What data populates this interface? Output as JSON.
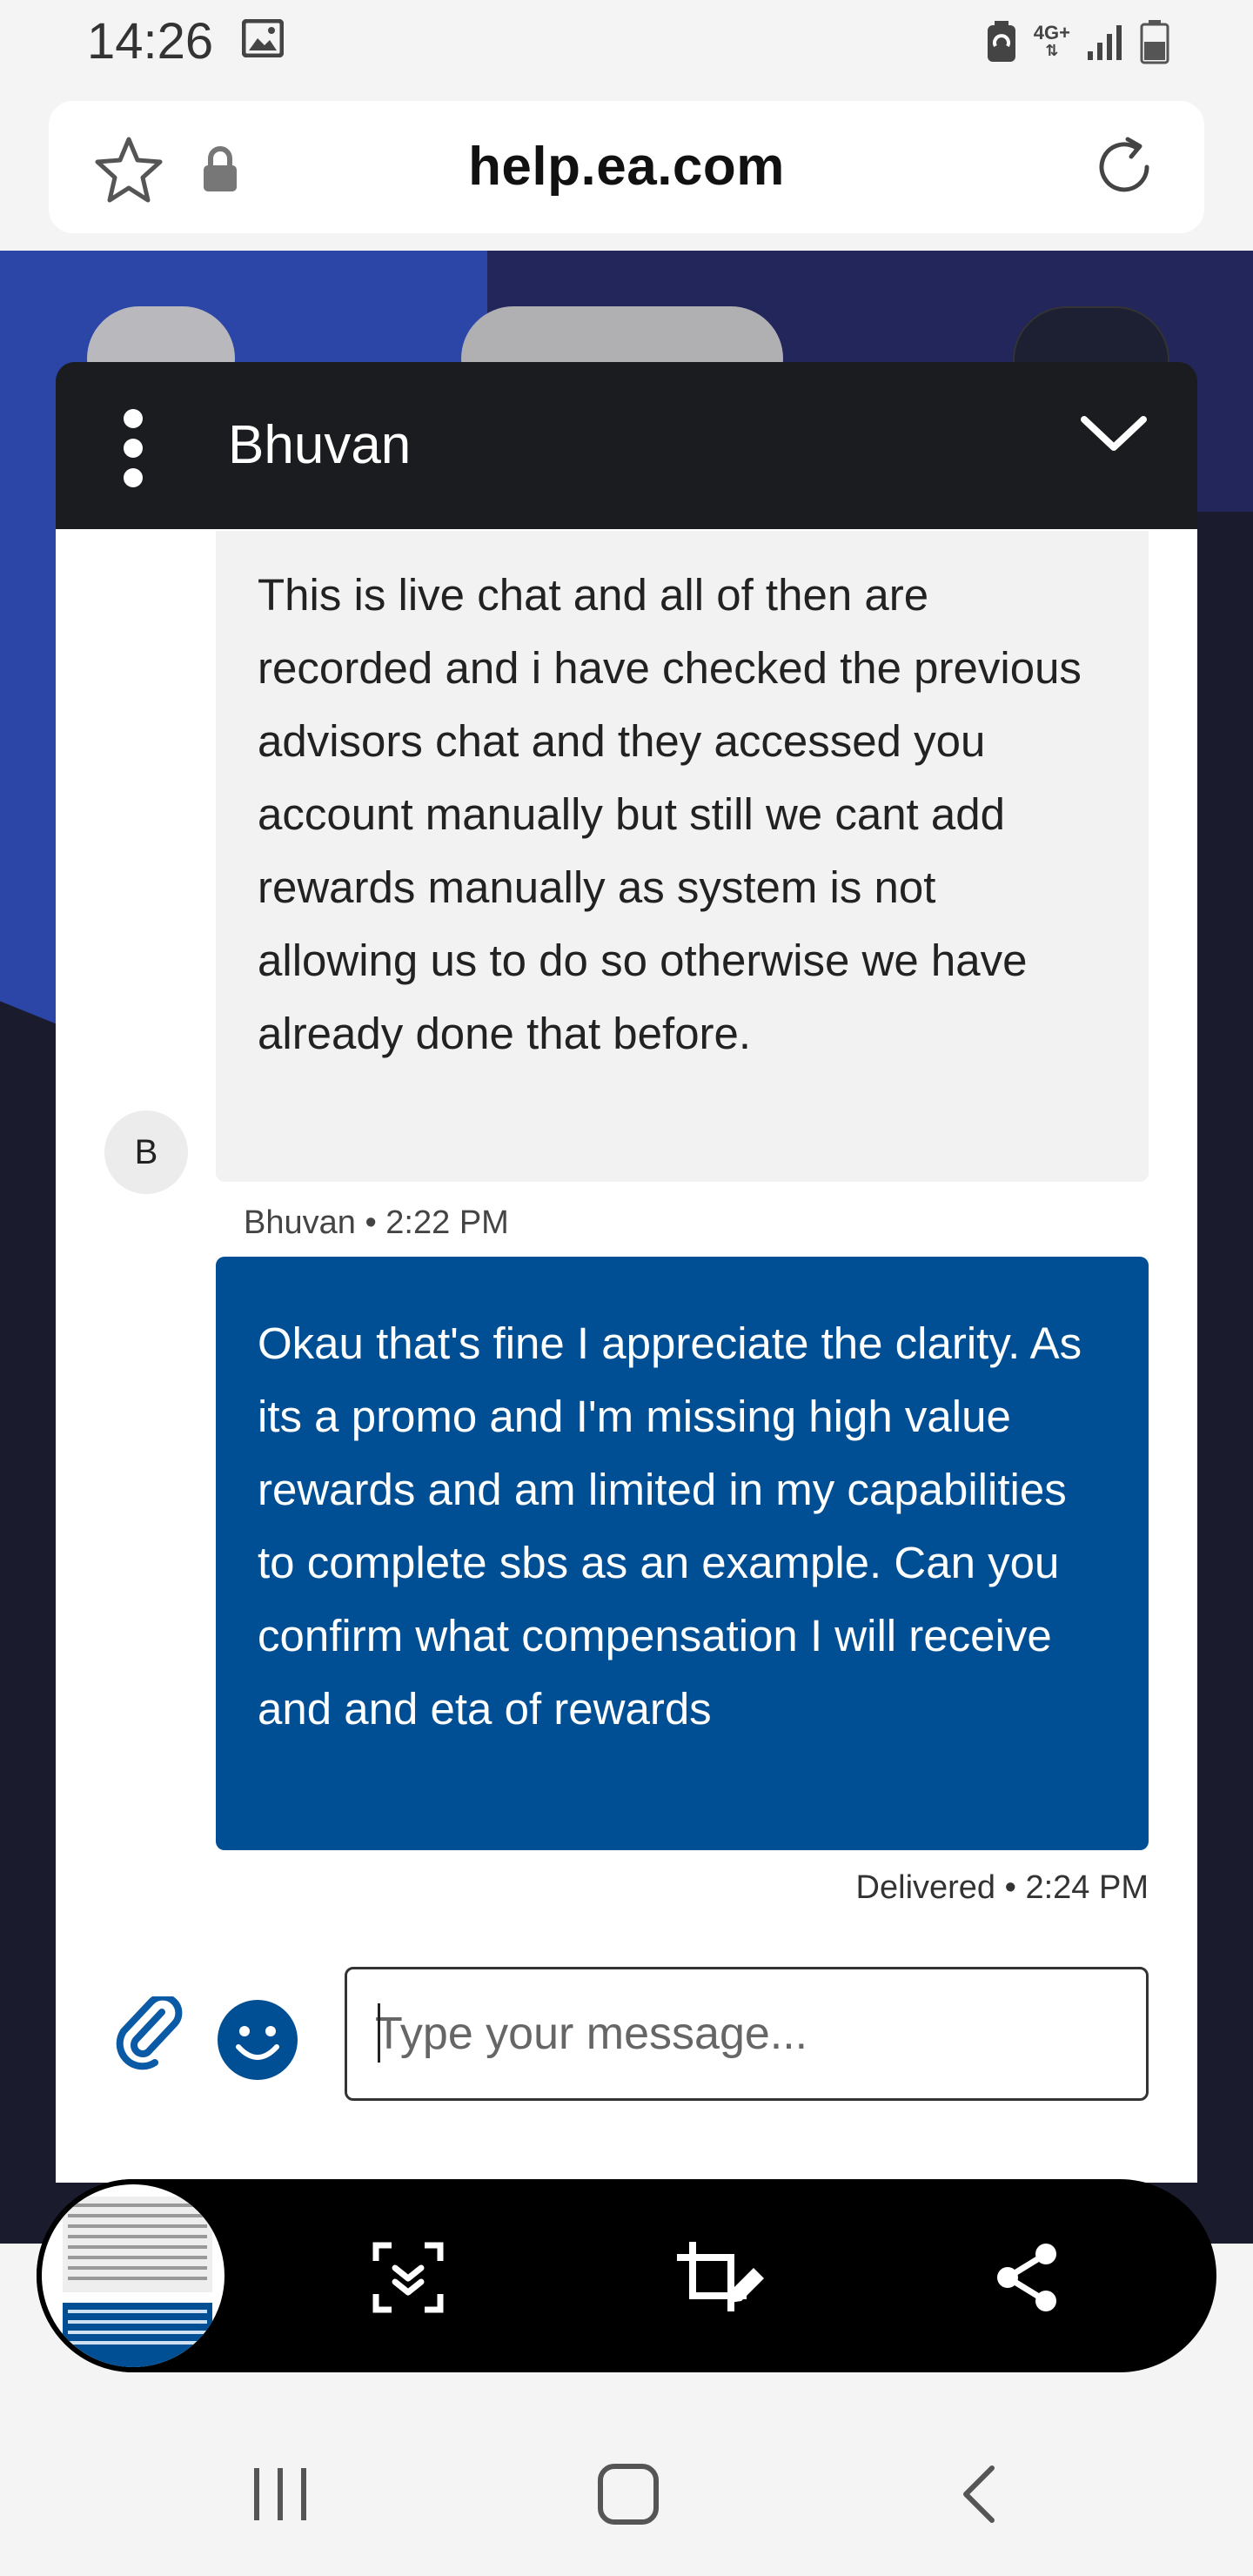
{
  "status_bar": {
    "time": "14:26",
    "network": "4G+",
    "icons": [
      "gallery-icon",
      "data-saver-icon",
      "signal-icon",
      "battery-icon"
    ]
  },
  "browser": {
    "url": "help.ea.com",
    "icons": [
      "star-icon",
      "lock-icon",
      "refresh-icon"
    ]
  },
  "chat": {
    "header": {
      "agent_name": "Bhuvan"
    },
    "messages": [
      {
        "from": "agent",
        "avatar_initial": "B",
        "text": "This is live chat and all of then are recorded and i have checked the previous advisors chat and they accessed you account manually but still we cant add rewards manually as system is not allowing us to do so otherwise we have already done that before.",
        "meta": "Bhuvan • 2:22 PM"
      },
      {
        "from": "user",
        "text": "Okau that's fine I appreciate the clarity. As its a promo and I'm missing high value rewards and am limited in my capabilities to complete sbs as an example. Can you confirm what compensation I will receive and and eta of rewards",
        "meta": "Delivered • 2:24 PM"
      }
    ],
    "input": {
      "placeholder": "Type your message...",
      "value": ""
    }
  },
  "colors": {
    "user_bubble": "#004f95",
    "agent_bubble": "#f2f2f2",
    "header": "#1b1c1f",
    "site_blue": "#2c46a8"
  },
  "screenshot_toolbar": {
    "icons": [
      "screenshot-thumbnail",
      "scroll-capture-icon",
      "crop-edit-icon",
      "share-icon"
    ]
  },
  "nav_bar": {
    "icons": [
      "recent-apps-icon",
      "home-icon",
      "back-icon"
    ]
  }
}
